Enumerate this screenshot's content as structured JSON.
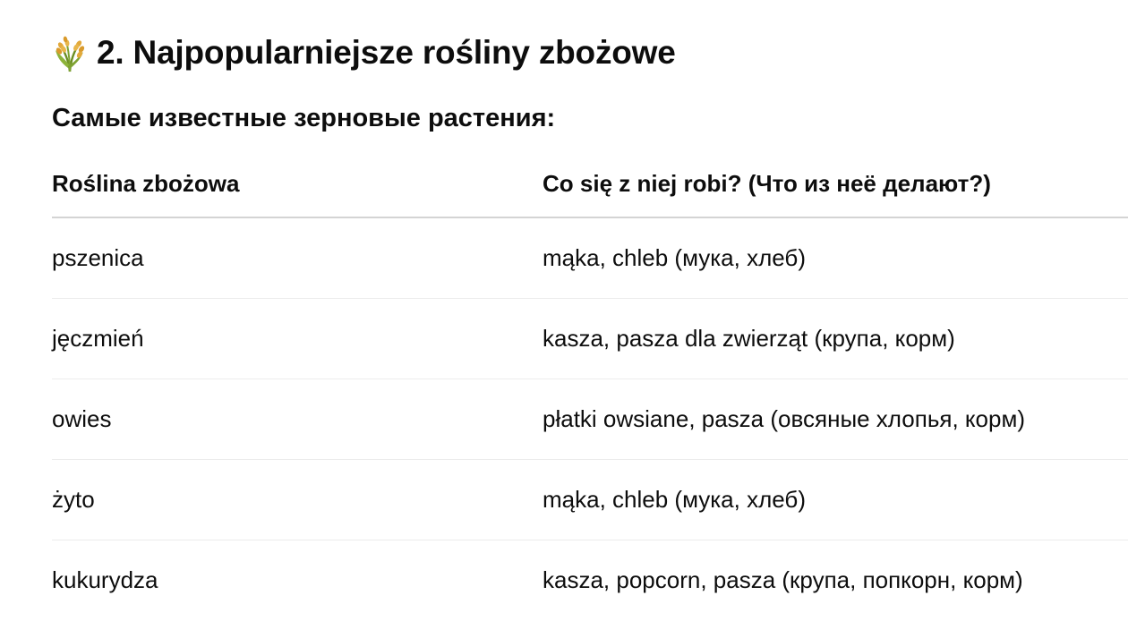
{
  "section": {
    "icon": "rice-sheaf-icon",
    "title": "2. Najpopularniejsze rośliny zbożowe",
    "subtitle": "Самые известные зерновые растения:"
  },
  "table": {
    "headers": [
      "Roślina zbożowa",
      "Co się z niej robi? (Что из неё делают?)"
    ],
    "rows": [
      {
        "plant": "pszenica",
        "use": "mąka, chleb (мука, хлеб)"
      },
      {
        "plant": "jęczmień",
        "use": "kasza, pasza dla zwierząt (крупа, корм)"
      },
      {
        "plant": "owies",
        "use": "płatki owsiane, pasza (овсяные хлопья, корм)"
      },
      {
        "plant": "żyto",
        "use": "mąka, chleb (мука, хлеб)"
      },
      {
        "plant": "kukurydza",
        "use": "kasza, popcorn, pasza (крупа, попкорн, корм)"
      }
    ]
  }
}
